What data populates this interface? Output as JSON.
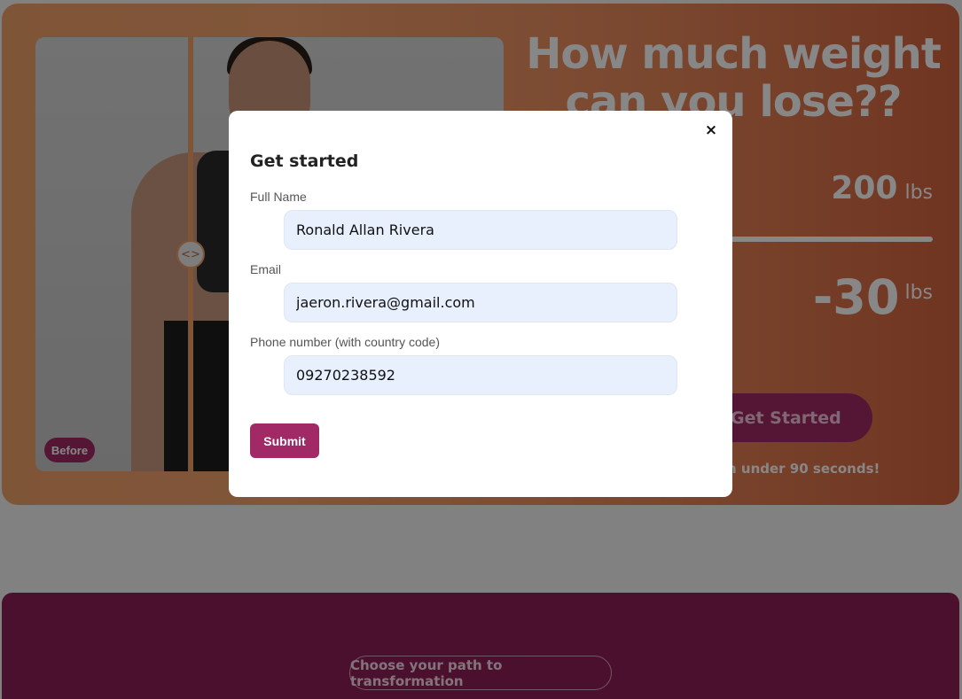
{
  "hero": {
    "title": "How much weight can you lose??",
    "before_badge": "Before",
    "compare_handle": "<>",
    "current_weight": {
      "value": "200",
      "unit": "lbs"
    },
    "loss_weight": {
      "value": "-30",
      "unit": "lbs"
    },
    "cta_label": "Get Started",
    "cta_note": "n under 90 seconds!"
  },
  "section2": {
    "path_label": "Choose your path to transformation"
  },
  "modal": {
    "close_label": "×",
    "title": "Get started",
    "fields": [
      {
        "label": "Full Name",
        "value": "Ronald Allan Rivera"
      },
      {
        "label": "Email",
        "value": "jaeron.rivera@gmail.com"
      },
      {
        "label": "Phone number (with country code)",
        "value": "09270238592"
      }
    ],
    "submit_label": "Submit"
  },
  "colors": {
    "brand": "#a12a66",
    "hero_orange": "#f0a06a",
    "input_bg": "#e8f0fe",
    "section2_bg": "#8e1f58"
  }
}
